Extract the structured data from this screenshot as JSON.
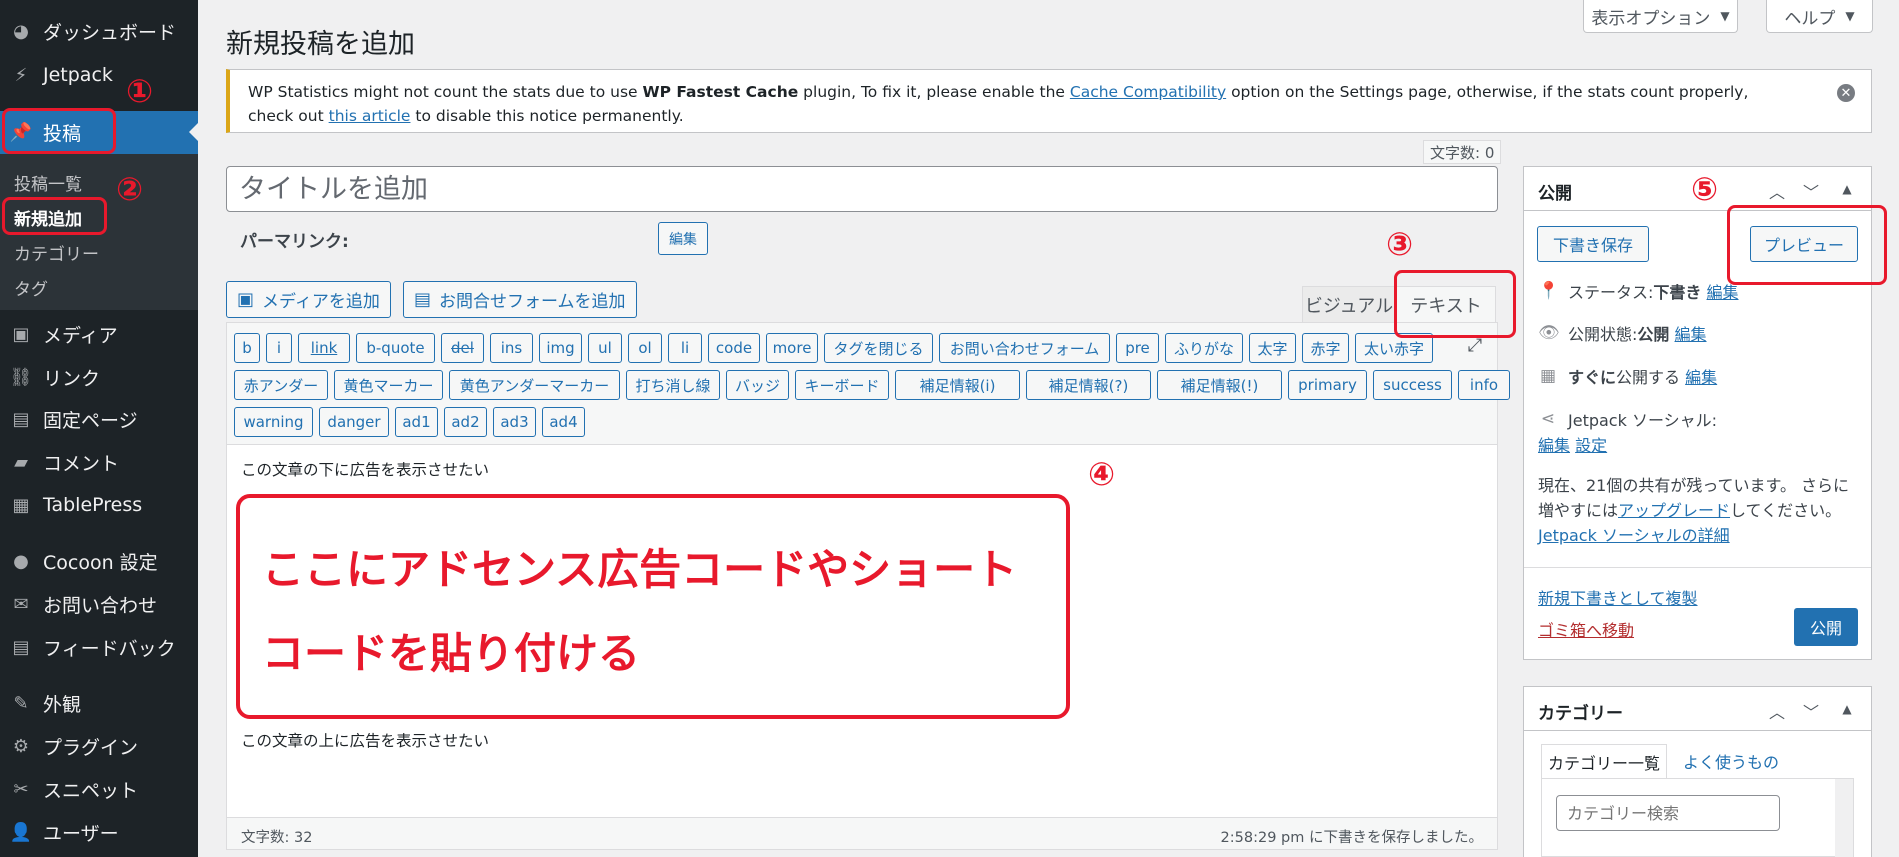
{
  "sidebar": {
    "items": [
      {
        "label": "ダッシュボード",
        "icon": "dashboard-icon"
      },
      {
        "label": "Jetpack",
        "icon": "jetpack-icon"
      },
      {
        "label": "投稿",
        "icon": "pin-icon"
      },
      {
        "label": "メディア",
        "icon": "media-icon"
      },
      {
        "label": "リンク",
        "icon": "link-icon"
      },
      {
        "label": "固定ページ",
        "icon": "page-icon"
      },
      {
        "label": "コメント",
        "icon": "comment-icon"
      },
      {
        "label": "TablePress",
        "icon": "table-icon"
      },
      {
        "label": "Cocoon 設定",
        "icon": "circle-icon"
      },
      {
        "label": "お問い合わせ",
        "icon": "mail-icon"
      },
      {
        "label": "フィードバック",
        "icon": "feedback-icon"
      },
      {
        "label": "外観",
        "icon": "brush-icon"
      },
      {
        "label": "プラグイン",
        "icon": "plugin-icon"
      },
      {
        "label": "スニペット",
        "icon": "scissors-icon"
      },
      {
        "label": "ユーザー",
        "icon": "user-icon"
      }
    ],
    "submenu": [
      "投稿一覧",
      "新規追加",
      "カテゴリー",
      "タグ"
    ]
  },
  "header": {
    "title": "新規投稿を追加",
    "screen_options": "表示オプション",
    "help": "ヘルプ"
  },
  "notice": {
    "part1": "WP Statistics might not count the stats due to use ",
    "bold": "WP Fastest Cache",
    "part2": " plugin, To fix it, please enable the ",
    "link1": "Cache Compatibility",
    "part3": " option on the Settings page, otherwise, if the stats count properly, check out ",
    "link2": "this article",
    "part4": " to disable this notice permanently."
  },
  "editor": {
    "char_count_top": "文字数: 0",
    "title_placeholder": "タイトルを追加",
    "permalink_label": "パーマリンク:",
    "permalink_edit": "編集",
    "add_media": "メディアを追加",
    "add_form": "お問合せフォームを追加",
    "tab_visual": "ビジュアル",
    "tab_text": "テキスト",
    "quicktags": [
      [
        "b",
        "i",
        "link",
        "b-quote",
        "del",
        "ins",
        "img",
        "ul",
        "ol",
        "li",
        "code",
        "more",
        "タグを閉じる",
        "お問い合わせフォーム",
        "pre",
        "ふりがな",
        "太字",
        "赤字",
        "太い赤字"
      ],
      [
        "赤アンダー",
        "黄色マーカー",
        "黄色アンダーマーカー",
        "打ち消し線",
        "バッジ",
        "キーボード",
        "補足情報(i)",
        "補足情報(?)",
        "補足情報(!)",
        "primary",
        "success",
        "info"
      ],
      [
        "warning",
        "danger",
        "ad1",
        "ad2",
        "ad3",
        "ad4"
      ]
    ],
    "line1": "この文章の下に広告を表示させたい",
    "line2": "この文章の上に広告を表示させたい",
    "word_count": "文字数: 32",
    "autosave": "2:58:29 pm に下書きを保存しました。"
  },
  "annotations": {
    "box_line1": "ここにアドセンス広告コードやショート",
    "box_line2": "コードを貼り付ける",
    "n1": "①",
    "n2": "②",
    "n3": "③",
    "n4": "④",
    "n5": "⑤",
    "color": "#e8192c"
  },
  "publish": {
    "title": "公開",
    "save_draft": "下書き保存",
    "preview": "プレビュー",
    "status_label": "ステータス: ",
    "status_value": "下書き",
    "visibility_label": "公開状態: ",
    "visibility_value": "公開",
    "schedule_bold": "すぐに",
    "schedule_rest": "公開する",
    "edit": "編集",
    "jetpack_social": "Jetpack ソーシャル:",
    "settings": "設定",
    "shares_text1": "現在、21個の共有が残っています。 さらに",
    "shares_text2a": "増やすには",
    "upgrade": "アップグレード",
    "shares_text2b": "してください。",
    "social_details": "Jetpack ソーシャルの詳細",
    "duplicate": "新規下書きとして複製",
    "trash": "ゴミ箱へ移動",
    "publish_btn": "公開"
  },
  "categories": {
    "title": "カテゴリー",
    "tab_all": "カテゴリー一覧",
    "tab_popular": "よく使うもの",
    "search_placeholder": "カテゴリー検索"
  },
  "colors": {
    "accent": "#2271b1",
    "sidebar": "#1d2327",
    "notice": "#dba617"
  }
}
